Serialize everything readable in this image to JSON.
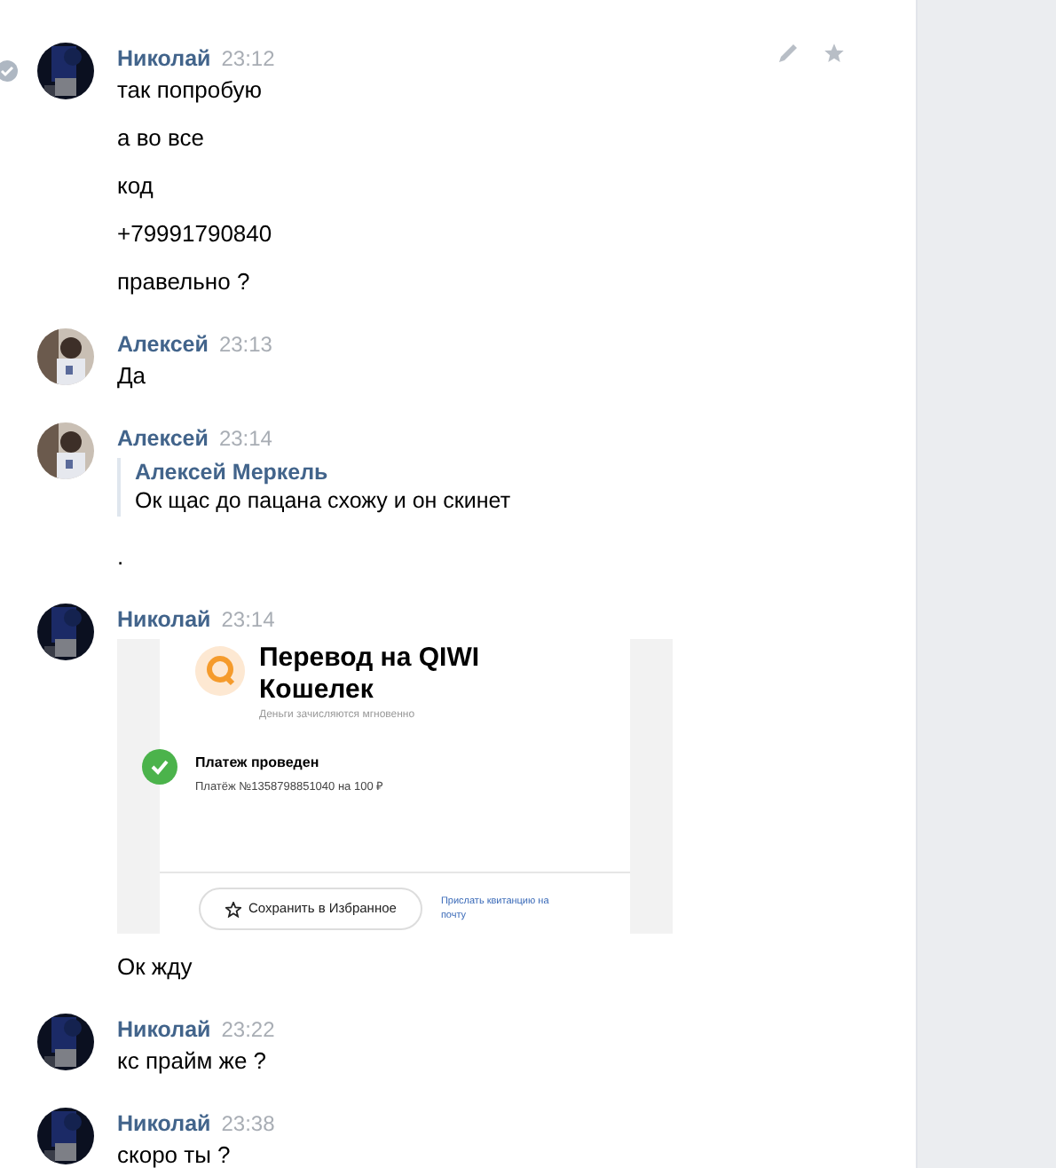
{
  "messages": [
    {
      "author": "Николай",
      "time": "23:12",
      "selected": true,
      "show_actions": true,
      "items": [
        {
          "kind": "text",
          "text": "так попробую"
        },
        {
          "kind": "text",
          "text": "а во все"
        },
        {
          "kind": "text",
          "text": "код"
        },
        {
          "kind": "text",
          "text": "+79991790840"
        },
        {
          "kind": "text",
          "text": "правельно ?"
        }
      ]
    },
    {
      "author": "Алексей",
      "time": "23:13",
      "selected": false,
      "show_actions": false,
      "items": [
        {
          "kind": "text",
          "text": "Да"
        }
      ]
    },
    {
      "author": "Алексей",
      "time": "23:14",
      "selected": false,
      "show_actions": false,
      "items": [
        {
          "kind": "quote",
          "author": "Алексей Меркель",
          "text": "Ок щас до пацана схожу и он скинет"
        },
        {
          "kind": "text",
          "text": "."
        }
      ]
    },
    {
      "author": "Николай",
      "time": "23:14",
      "selected": false,
      "show_actions": false,
      "items": [
        {
          "kind": "receipt",
          "title": "Перевод на QIWI Кошелек",
          "subtitle": "Деньги зачисляются мгновенно",
          "status": "Платеж проведен",
          "detail": "Платёж №1358798851040 на 100 ₽",
          "save_button": "Сохранить в Избранное",
          "link": "Прислать квитанцию на почту"
        },
        {
          "kind": "text",
          "text": "Ок жду"
        }
      ]
    },
    {
      "author": "Николай",
      "time": "23:22",
      "selected": false,
      "show_actions": false,
      "items": [
        {
          "kind": "text",
          "text": "кс прайм же ?"
        }
      ]
    },
    {
      "author": "Николай",
      "time": "23:38",
      "selected": false,
      "show_actions": false,
      "items": [
        {
          "kind": "text",
          "text": "скоро ты ?"
        }
      ]
    }
  ]
}
